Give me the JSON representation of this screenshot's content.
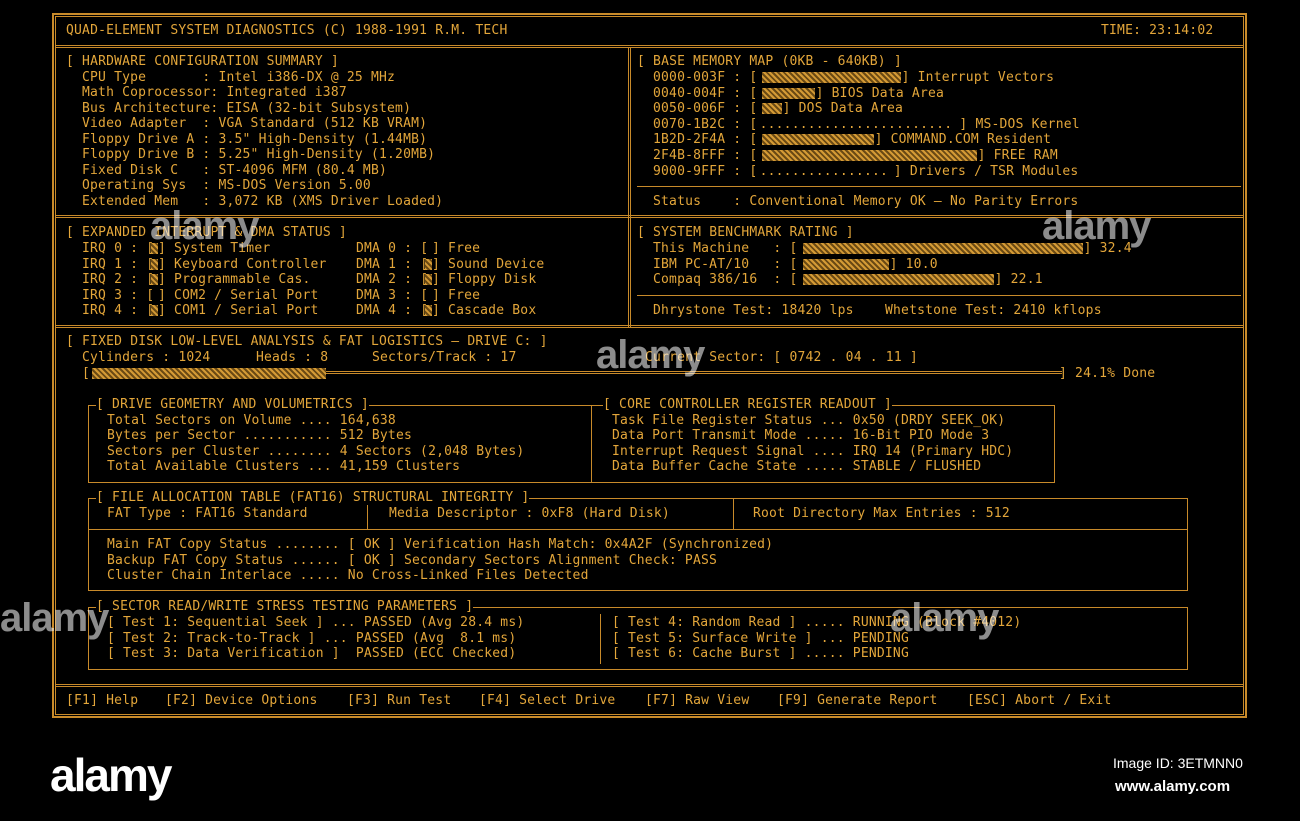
{
  "header": {
    "title": "QUAD-ELEMENT SYSTEM DIAGNOSTICS (C) 1988-1991 R.M. TECH",
    "time": "TIME: 23:14:02"
  },
  "hardware": {
    "heading": "[ HARDWARE CONFIGURATION SUMMARY ]",
    "lines": [
      "CPU Type       : Intel i386-DX @ 25 MHz",
      "Math Coprocessor: Integrated i387",
      "Bus Architecture: EISA (32-bit Subsystem)",
      "Video Adapter  : VGA Standard (512 KB VRAM)",
      "Floppy Drive A : 3.5\" High-Density (1.44MB)",
      "Floppy Drive B : 5.25\" High-Density (1.20MB)",
      "Fixed Disk C   : ST-4096 MFM (80.4 MB)",
      "Operating Sys  : MS-DOS Version 5.00",
      "Extended Mem   : 3,072 KB (XMS Driver Loaded)"
    ]
  },
  "memory_map": {
    "heading": "[ BASE MEMORY MAP (0KB - 640KB) ]",
    "rows": [
      {
        "range": "0000-003F : [",
        "fill": 0.42,
        "label": "] Interrupt Vectors"
      },
      {
        "range": "0040-004F : [",
        "fill": 0.16,
        "label": "] BIOS Data Area"
      },
      {
        "range": "0050-006F : [",
        "fill": 0.06,
        "label": "] DOS Data Area"
      },
      {
        "range": "0070-1B2C : [",
        "dots": "........................",
        "label": "] MS-DOS Kernel"
      },
      {
        "range": "1B2D-2F4A : [",
        "fill": 0.34,
        "label": "] COMMAND.COM Resident"
      },
      {
        "range": "2F4B-8FFF : [",
        "fill": 0.65,
        "label": "] FREE RAM"
      },
      {
        "range": "9000-9FFF : [",
        "dots": "................",
        "label": "] Drivers / TSR Modules"
      }
    ],
    "status": "Status    : Conventional Memory OK — No Parity Errors"
  },
  "irq": {
    "heading": "[ EXPANDED INTERRUPT & DMA STATUS ]",
    "rows": [
      {
        "irq": "IRQ 0 : [",
        "irq_on": true,
        "irq_label": "] System Timer",
        "dma": "DMA 0 : [",
        "dma_on": false,
        "dma_label": "] Free"
      },
      {
        "irq": "IRQ 1 : [",
        "irq_on": true,
        "irq_label": "] Keyboard Controller",
        "dma": "DMA 1 : [",
        "dma_on": true,
        "dma_label": "] Sound Device"
      },
      {
        "irq": "IRQ 2 : [",
        "irq_on": true,
        "irq_label": "] Programmable Cas.",
        "dma": "DMA 2 : [",
        "dma_on": true,
        "dma_label": "] Floppy Disk"
      },
      {
        "irq": "IRQ 3 : [",
        "irq_on": false,
        "irq_label": "] COM2 / Serial Port",
        "dma": "DMA 3 : [",
        "dma_on": false,
        "dma_label": "] Free"
      },
      {
        "irq": "IRQ 4 : [",
        "irq_on": true,
        "irq_label": "] COM1 / Serial Port",
        "dma": "DMA 4 : [",
        "dma_on": true,
        "dma_label": "] Cascade Box"
      }
    ]
  },
  "benchmark": {
    "heading": "[ SYSTEM BENCHMARK RATING ]",
    "rows": [
      {
        "label": "This Machine   : [",
        "value": "] 32.4",
        "score": 32.4
      },
      {
        "label": "IBM PC-AT/10   : [",
        "value": "] 10.0",
        "score": 10.0
      },
      {
        "label": "Compaq 386/16  : [",
        "value": "] 22.1",
        "score": 22.1
      }
    ],
    "dhrystone": "Dhrystone Test: 18420 lps",
    "whetstone": "Whetstone Test: 2410 kflops"
  },
  "disk": {
    "heading": "[ FIXED DISK LOW-LEVEL ANALYSIS & FAT LOGISTICS — DRIVE C: ]",
    "cylinders": "Cylinders : 1024",
    "heads": "Heads : 8",
    "sectors": "Sectors/Track : 17",
    "current_sector": "Current Sector: [ 0742 . 04 . 11 ]",
    "progress_open": "[",
    "progress_close": "] 24.1% Done",
    "progress": 0.241
  },
  "geometry": {
    "heading": "[ DRIVE GEOMETRY AND VOLUMETRICS ]",
    "lines": [
      "Total Sectors on Volume .... 164,638",
      "Bytes per Sector ........... 512 Bytes",
      "Sectors per Cluster ........ 4 Sectors (2,048 Bytes)",
      "Total Available Clusters ... 41,159 Clusters"
    ]
  },
  "controller": {
    "heading": "[ CORE CONTROLLER REGISTER READOUT ]",
    "lines": [
      "Task File Register Status ... 0x50 (DRDY SEEK_OK)",
      "Data Port Transmit Mode ..... 16-Bit PIO Mode 3",
      "Interrupt Request Signal .... IRQ 14 (Primary HDC)",
      "Data Buffer Cache State ..... STABLE / FLUSHED"
    ]
  },
  "fat": {
    "heading": "[ FILE ALLOCATION TABLE (FAT16) STRUCTURAL INTEGRITY ]",
    "type": "FAT Type : FAT16 Standard",
    "media": "Media Descriptor : 0xF8 (Hard Disk)",
    "root": "Root Directory Max Entries : 512",
    "lines": [
      "Main FAT Copy Status ........ [ OK ] Verification Hash Match: 0x4A2F (Synchronized)",
      "Backup FAT Copy Status ...... [ OK ] Secondary Sectors Alignment Check: PASS",
      "Cluster Chain Interlace ..... No Cross-Linked Files Detected"
    ]
  },
  "stress": {
    "heading": "[ SECTOR READ/WRITE STRESS TESTING PARAMETERS ]",
    "left": [
      "[ Test 1: Sequential Seek ] ... PASSED (Avg 28.4 ms)",
      "[ Test 2: Track-to-Track ] ... PASSED (Avg  8.1 ms)",
      "[ Test 3: Data Verification ]  PASSED (ECC Checked)"
    ],
    "right": [
      "[ Test 4: Random Read ] ..... RUNNING (Block #4012)",
      "[ Test 5: Surface Write ] ... PENDING",
      "[ Test 6: Cache Burst ] ..... PENDING"
    ]
  },
  "fkeys": {
    "f1": "[F1] Help",
    "f2": "[F2] Device Options",
    "f3": "[F3] Run Test",
    "f4": "[F4] Select Drive",
    "f7": "[F7] Raw View",
    "f9": "[F9] Generate Report",
    "esc": "[ESC] Abort / Exit"
  },
  "watermark": {
    "brand": "alamy",
    "image_id": "Image ID: 3ETMNN0",
    "url": "www.alamy.com"
  },
  "colors": {
    "amber": "#e3a63a",
    "frame": "#c88a2a",
    "background": "#000000"
  }
}
